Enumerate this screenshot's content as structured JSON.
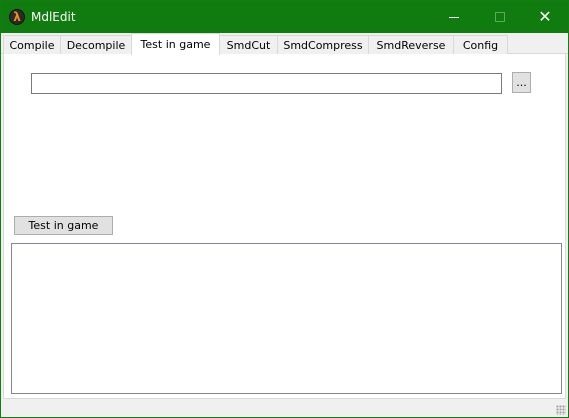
{
  "window": {
    "title": "MdlEdit",
    "icon": "half-life-lambda-icon",
    "icon_glyph": "λ",
    "controls": {
      "minimize": "minimize-icon",
      "maximize": "maximize-icon",
      "close": "close-icon",
      "close_glyph": "✕"
    },
    "colors": {
      "titlebar": "#107c10"
    }
  },
  "tabs": [
    {
      "label": "Compile",
      "active": false
    },
    {
      "label": "Decompile",
      "active": false
    },
    {
      "label": "Test in game",
      "active": true
    },
    {
      "label": "SmdCut",
      "active": false
    },
    {
      "label": "SmdCompress",
      "active": false
    },
    {
      "label": "SmdReverse",
      "active": false
    },
    {
      "label": "Config",
      "active": false
    }
  ],
  "panel": {
    "path_input": {
      "value": "",
      "placeholder": ""
    },
    "browse_label": "...",
    "test_button_label": "Test in game",
    "output_text": ""
  }
}
